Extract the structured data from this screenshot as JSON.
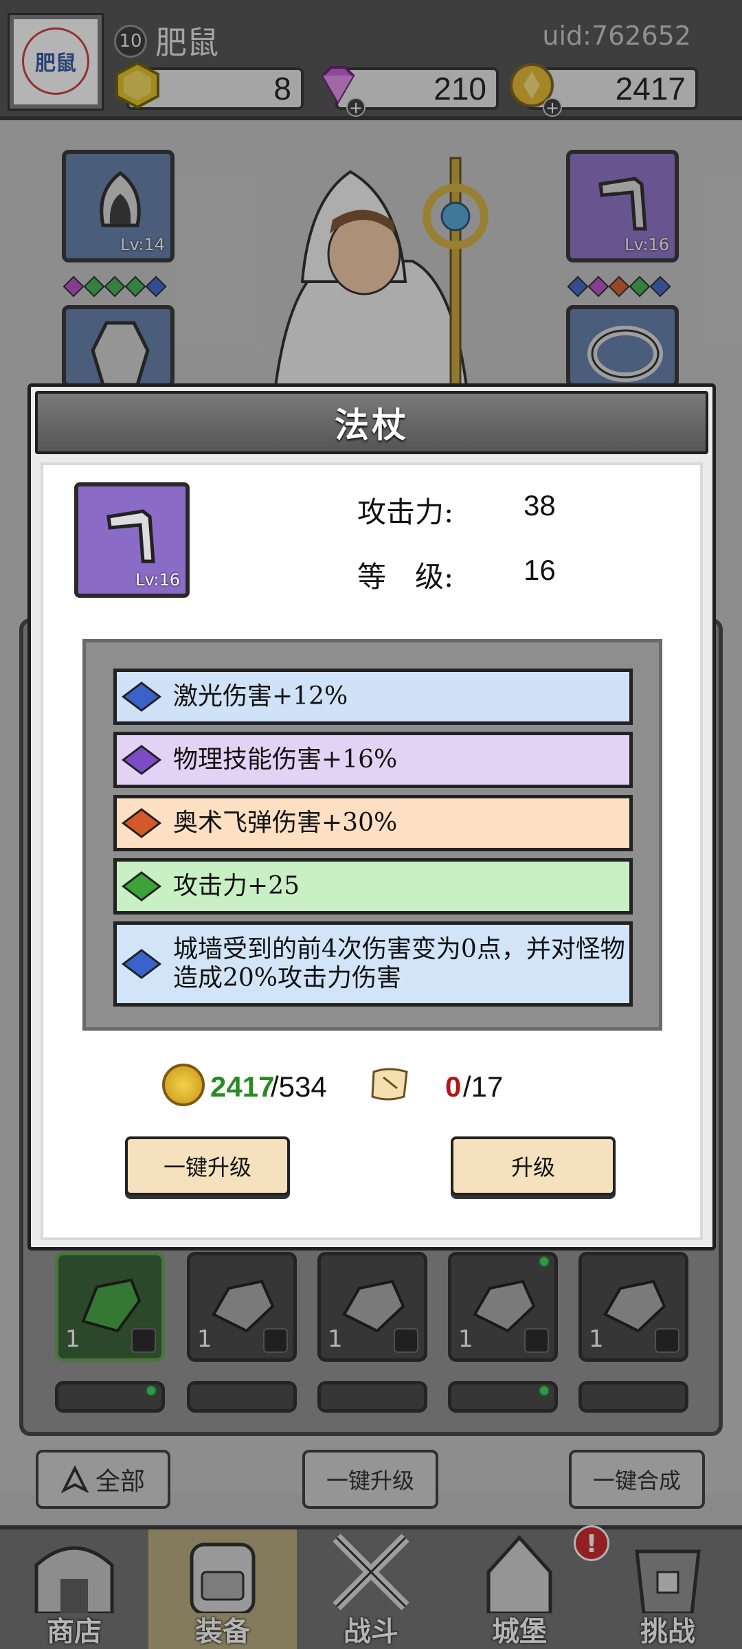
{
  "header": {
    "player_level": "10",
    "player_name": "肥鼠",
    "uid": "uid:762652",
    "avatar_text": "肥鼠",
    "resources": {
      "hex_coin": "8",
      "gems": "210",
      "gold": "2417"
    }
  },
  "equipment_slots": {
    "helmet_level": "Lv:14",
    "weapon_level": "Lv:16"
  },
  "dialog": {
    "title": "法杖",
    "item_level_badge": "Lv:16",
    "stats": [
      {
        "label": "攻击力:",
        "value": "38"
      },
      {
        "label": "等　级:",
        "value": "16"
      }
    ],
    "attributes": [
      {
        "text": "激光伤害+12%",
        "color": "#cfe2f7",
        "gem": "#3a62c8"
      },
      {
        "text": "物理技能伤害+16%",
        "color": "#e2d3f4",
        "gem": "#7e4bc7"
      },
      {
        "text": "奥术飞弹伤害+30%",
        "color": "#fde0c4",
        "gem": "#d5582a"
      },
      {
        "text": "攻击力+25",
        "color": "#c9f0c4",
        "gem": "#3ba33a"
      },
      {
        "text": "城墙受到的前4次伤害变为0点，并对怪物造成20%攻击力伤害",
        "color": "#d2e4f8",
        "gem": "#3a62c8"
      }
    ],
    "cost": {
      "gold_have": "2417",
      "gold_need": "/534",
      "scroll_have": "0",
      "scroll_need": "/17"
    },
    "buttons": {
      "one_click_upgrade": "一键升级",
      "upgrade": "升级"
    }
  },
  "inventory": {
    "counts": [
      "1",
      "1",
      "1",
      "1",
      "1"
    ]
  },
  "controls": {
    "filter_all": "全部",
    "one_click_upgrade": "一键升级",
    "one_click_merge": "一键合成"
  },
  "nav": {
    "items": [
      "商店",
      "装备",
      "战斗",
      "城堡",
      "挑战"
    ],
    "alert": "!"
  },
  "colors": {
    "gold_have": "#2a8a24",
    "scroll_have": "#b01818",
    "button_bg": "#f6e1bf"
  }
}
